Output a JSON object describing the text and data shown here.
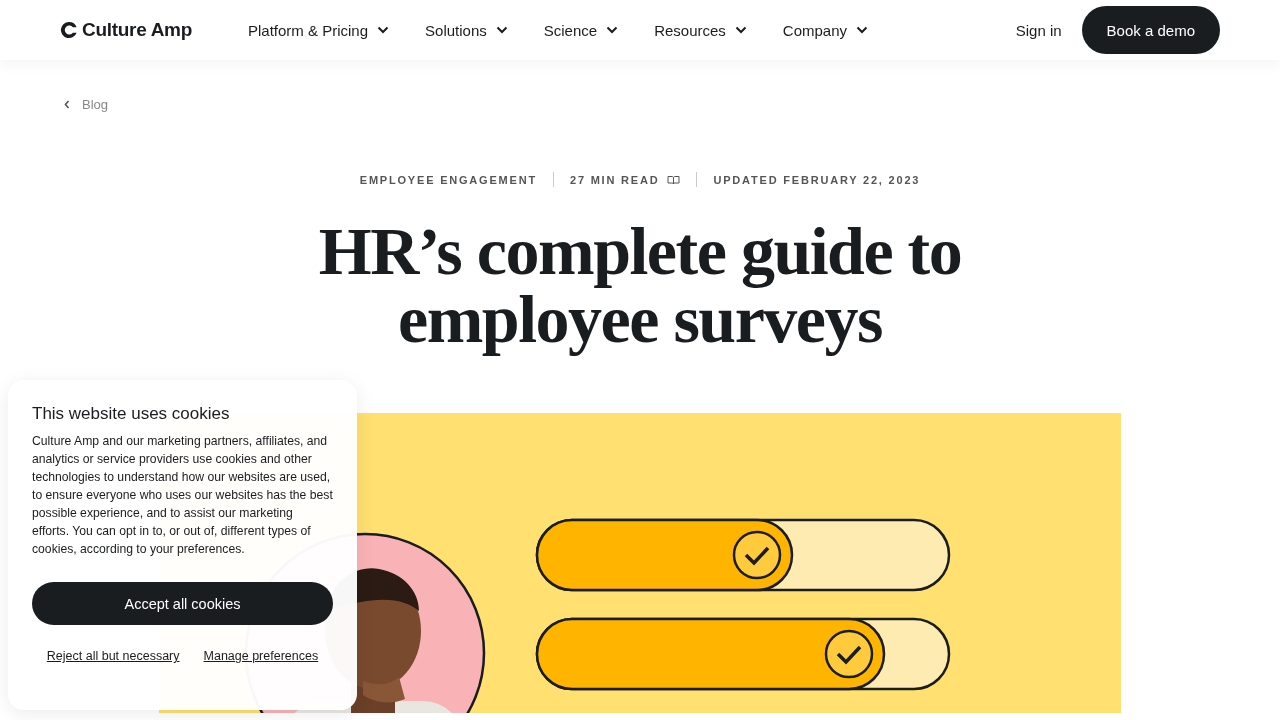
{
  "header": {
    "logo": "Culture Amp",
    "nav": [
      {
        "label": "Platform & Pricing"
      },
      {
        "label": "Solutions"
      },
      {
        "label": "Science"
      },
      {
        "label": "Resources"
      },
      {
        "label": "Company"
      }
    ],
    "sign_in": "Sign in",
    "cta": "Book a demo"
  },
  "breadcrumb": "Blog",
  "meta": {
    "category": "EMPLOYEE ENGAGEMENT",
    "read_time": "27 MIN READ",
    "updated": "UPDATED FEBRUARY 22, 2023"
  },
  "title": "HR’s complete guide to employee surveys",
  "cookie_banner": {
    "title": "This website uses cookies",
    "body": "Culture Amp and our marketing partners, affiliates, and analytics or service providers use cookies and other technologies to understand how our websites are used, to ensure everyone who uses our websites has the best possible experience, and to assist our marketing efforts. You can opt in to, or out of, different types of cookies, according to your preferences.",
    "accept": "Accept all cookies",
    "reject": "Reject all but necessary",
    "manage": "Manage preferences"
  }
}
